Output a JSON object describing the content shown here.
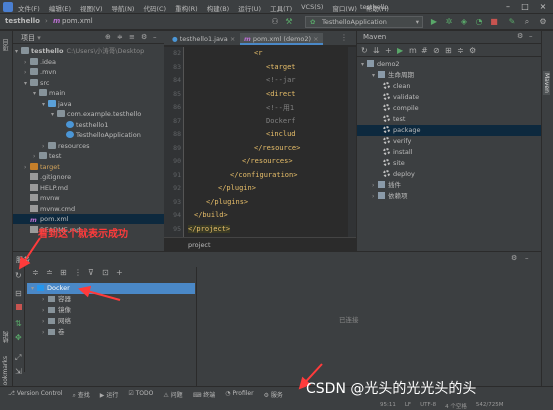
{
  "titlebar": {
    "menus": [
      "文件(F)",
      "编辑(E)",
      "视图(V)",
      "导航(N)",
      "代码(C)",
      "重构(R)",
      "构建(B)",
      "运行(U)",
      "工具(T)",
      "VCS(S)",
      "窗口(W)",
      "帮助(H)"
    ],
    "window_title": "testhello"
  },
  "breadcrumb": {
    "project": "testhello",
    "file": "pom.xml"
  },
  "run_config": "TesthelloApplication",
  "left_strip_labels": [
    "项目"
  ],
  "project_panel": {
    "title": "项目",
    "rows": [
      {
        "text": "testhello",
        "extra": "C:\\Users\\小涛哥\\Desktop",
        "indent": 0,
        "arrow": "▾",
        "icon": "folder",
        "bold": true
      },
      {
        "text": ".idea",
        "indent": 1,
        "arrow": "›",
        "icon": "folder"
      },
      {
        "text": ".mvn",
        "indent": 1,
        "arrow": "›",
        "icon": "folder"
      },
      {
        "text": "src",
        "indent": 1,
        "arrow": "▾",
        "icon": "folder"
      },
      {
        "text": "main",
        "indent": 2,
        "arrow": "▾",
        "icon": "folder"
      },
      {
        "text": "java",
        "indent": 3,
        "arrow": "▾",
        "icon": "folder blue"
      },
      {
        "text": "com.example.testhello",
        "indent": 4,
        "arrow": "▾",
        "icon": "folder"
      },
      {
        "text": "testhello1",
        "indent": 5,
        "arrow": "",
        "icon": "cls"
      },
      {
        "text": "TesthelloApplication",
        "indent": 5,
        "arrow": "",
        "icon": "cls"
      },
      {
        "text": "resources",
        "indent": 3,
        "arrow": "›",
        "icon": "folder"
      },
      {
        "text": "test",
        "indent": 2,
        "arrow": "›",
        "icon": "folder"
      },
      {
        "text": "target",
        "indent": 1,
        "arrow": "›",
        "icon": "folder orange"
      },
      {
        "text": ".gitignore",
        "indent": 1,
        "arrow": "",
        "icon": "filei"
      },
      {
        "text": "HELP.md",
        "indent": 1,
        "arrow": "",
        "icon": "filei"
      },
      {
        "text": "mvnw",
        "indent": 1,
        "arrow": "",
        "icon": "filei"
      },
      {
        "text": "mvnw.cmd",
        "indent": 1,
        "arrow": "",
        "icon": "filei"
      },
      {
        "text": "pom.xml",
        "indent": 1,
        "arrow": "",
        "icon": "m"
      },
      {
        "text": "README.md",
        "indent": 1,
        "arrow": "",
        "icon": "filei"
      }
    ]
  },
  "editor": {
    "tabs": [
      "testhello1.java",
      "pom.xml (demo2)"
    ],
    "lines": [
      {
        "n": "82",
        "text": "<r",
        "indent": 11
      },
      {
        "n": "83",
        "text": "<target",
        "indent": 13
      },
      {
        "n": "84",
        "text": "<!--jar",
        "indent": 13,
        "dim": true
      },
      {
        "n": "85",
        "text": "<direct",
        "indent": 13
      },
      {
        "n": "86",
        "text": "<!--用1",
        "indent": 13,
        "dim": true
      },
      {
        "n": "87",
        "text": "Dockerf",
        "indent": 13,
        "dim": true
      },
      {
        "n": "88",
        "text": "<includ",
        "indent": 13
      },
      {
        "n": "89",
        "text": "</resource>",
        "indent": 11
      },
      {
        "n": "90",
        "text": "</resources>",
        "indent": 9
      },
      {
        "n": "91",
        "text": "</configuration>",
        "indent": 7
      },
      {
        "n": "92",
        "text": "</plugin>",
        "indent": 5
      },
      {
        "n": "93",
        "text": "</plugins>",
        "indent": 3
      },
      {
        "n": "94",
        "text": "</build>",
        "indent": 1
      },
      {
        "n": "95",
        "text": "</project>",
        "indent": 0,
        "hl": true
      }
    ],
    "footer": "project"
  },
  "maven": {
    "title": "Maven",
    "rows": [
      {
        "text": "demo2",
        "indent": 0,
        "arrow": "▾"
      },
      {
        "text": "生命周期",
        "indent": 1,
        "arrow": "▾"
      },
      {
        "text": "clean",
        "indent": 2,
        "gear": true
      },
      {
        "text": "validate",
        "indent": 2,
        "gear": true
      },
      {
        "text": "compile",
        "indent": 2,
        "gear": true
      },
      {
        "text": "test",
        "indent": 2,
        "gear": true
      },
      {
        "text": "package",
        "indent": 2,
        "gear": true,
        "selected": true
      },
      {
        "text": "verify",
        "indent": 2,
        "gear": true
      },
      {
        "text": "install",
        "indent": 2,
        "gear": true
      },
      {
        "text": "site",
        "indent": 2,
        "gear": true
      },
      {
        "text": "deploy",
        "indent": 2,
        "gear": true
      },
      {
        "text": "插件",
        "indent": 1,
        "arrow": "›"
      },
      {
        "text": "依赖项",
        "indent": 1,
        "arrow": "›"
      }
    ]
  },
  "right_strip_labels": [
    "Maven"
  ],
  "services": {
    "title": "服务",
    "tree": [
      {
        "text": "Docker",
        "indent": 0,
        "arrow": "▾",
        "selected": true
      },
      {
        "text": "容器",
        "indent": 1,
        "arrow": "›"
      },
      {
        "text": "镜像",
        "indent": 1,
        "arrow": "›"
      },
      {
        "text": "网络",
        "indent": 1,
        "arrow": "›"
      },
      {
        "text": "卷",
        "indent": 1,
        "arrow": "›"
      }
    ],
    "empty_text": "已连接"
  },
  "left_bottom_labels": [
    "结构",
    "Bookmarks"
  ],
  "statusbar": {
    "items": [
      "Version Control",
      "查找",
      "运行",
      "TODO",
      "问题",
      "终端",
      "Profiler",
      "服务"
    ],
    "right": [
      "95:11",
      "LF",
      "UTF-8",
      "4 个空格",
      "542/725M"
    ]
  },
  "annotation": "看到这个就表示成功",
  "watermark": "CSDN @光头的光光头的头",
  "colors": {
    "accent": "#4a88c7",
    "annotation": "#ff3b3b",
    "run_green": "#59a869"
  }
}
